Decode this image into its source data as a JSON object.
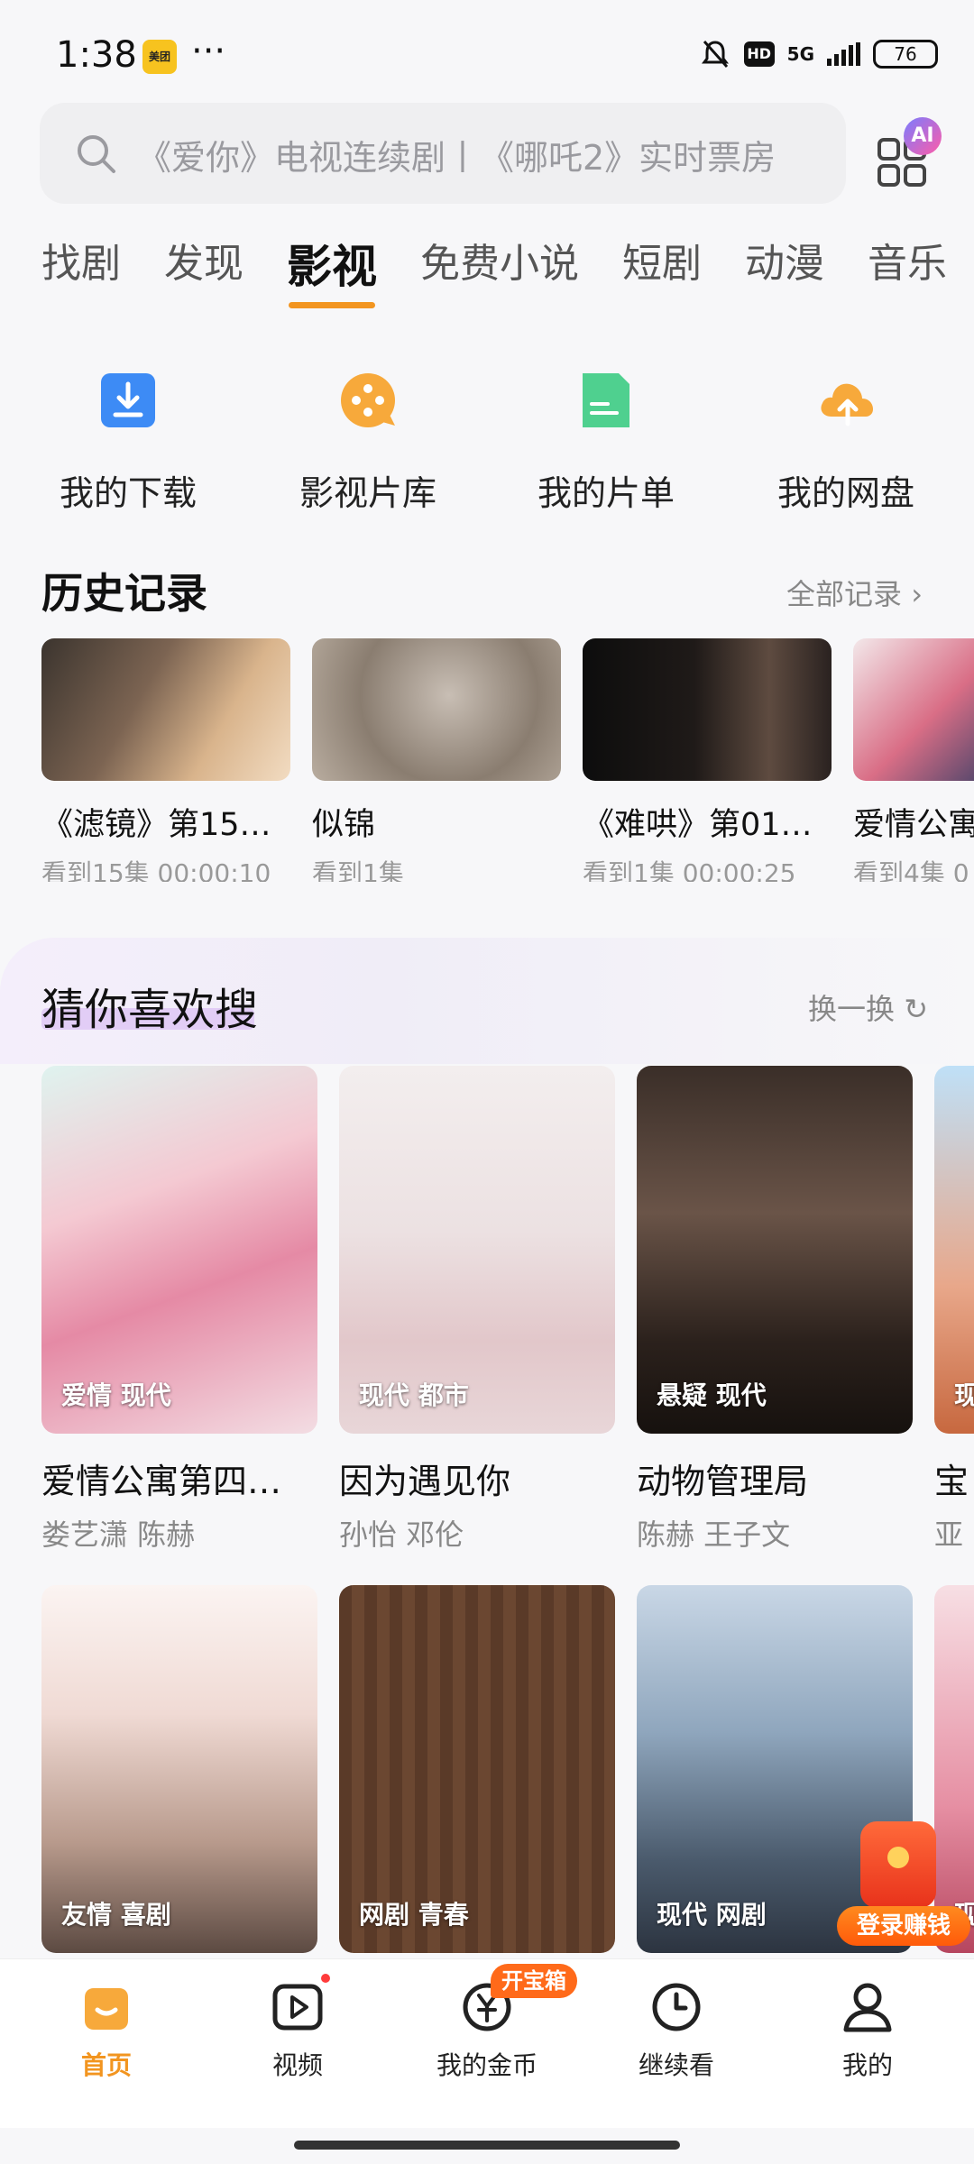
{
  "status_bar": {
    "time": "1:38",
    "app_badge": "美团",
    "more": "···",
    "hd": "HD",
    "signal": "5G",
    "battery": "76"
  },
  "search": {
    "placeholder": "《爱你》电视连续剧丨《哪吒2》实时票房",
    "ai_label": "AI"
  },
  "tabs": [
    {
      "label": "找剧",
      "active": false
    },
    {
      "label": "发现",
      "active": false
    },
    {
      "label": "影视",
      "active": true
    },
    {
      "label": "免费小说",
      "active": false
    },
    {
      "label": "短剧",
      "active": false
    },
    {
      "label": "动漫",
      "active": false
    },
    {
      "label": "音乐",
      "active": false
    }
  ],
  "quick_actions": [
    {
      "label": "我的下载",
      "icon": "download-icon"
    },
    {
      "label": "影视片库",
      "icon": "film-reel-icon"
    },
    {
      "label": "我的片单",
      "icon": "list-icon"
    },
    {
      "label": "我的网盘",
      "icon": "cloud-upload-icon"
    }
  ],
  "history": {
    "title": "历史记录",
    "link": "全部记录",
    "items": [
      {
        "title": "《滤镜》第15…",
        "sub": "看到15集 00:00:10"
      },
      {
        "title": "似锦",
        "sub": "看到1集"
      },
      {
        "title": "《难哄》第01…",
        "sub": "看到1集 00:00:25"
      },
      {
        "title": "爱情公寓",
        "sub": "看到4集 0"
      }
    ]
  },
  "recommend": {
    "title": "猜你喜欢搜",
    "refresh": "换一换",
    "row1": [
      {
        "title": "爱情公寓第四…",
        "tags": "爱情 现代",
        "cast": "娄艺潇 陈赫"
      },
      {
        "title": "因为遇见你",
        "tags": "现代 都市",
        "cast": "孙怡 邓伦"
      },
      {
        "title": "动物管理局",
        "tags": "悬疑 现代",
        "cast": "陈赫 王子文"
      },
      {
        "title": "宝",
        "tags": "现",
        "cast": "亚"
      }
    ],
    "row2": [
      {
        "tags": "友情 喜剧"
      },
      {
        "tags": "网剧 青春"
      },
      {
        "tags": "现代 网剧"
      },
      {
        "tags": "现"
      }
    ]
  },
  "promo": {
    "label": "登录赚钱"
  },
  "bottom_nav": [
    {
      "label": "首页",
      "active": true
    },
    {
      "label": "视频",
      "active": false
    },
    {
      "label": "我的金币",
      "active": false,
      "badge": "开宝箱"
    },
    {
      "label": "继续看",
      "active": false
    },
    {
      "label": "我的",
      "active": false
    }
  ],
  "colors": {
    "accent": "#f29520",
    "text_secondary": "#888888",
    "background": "#f7f7f9"
  }
}
